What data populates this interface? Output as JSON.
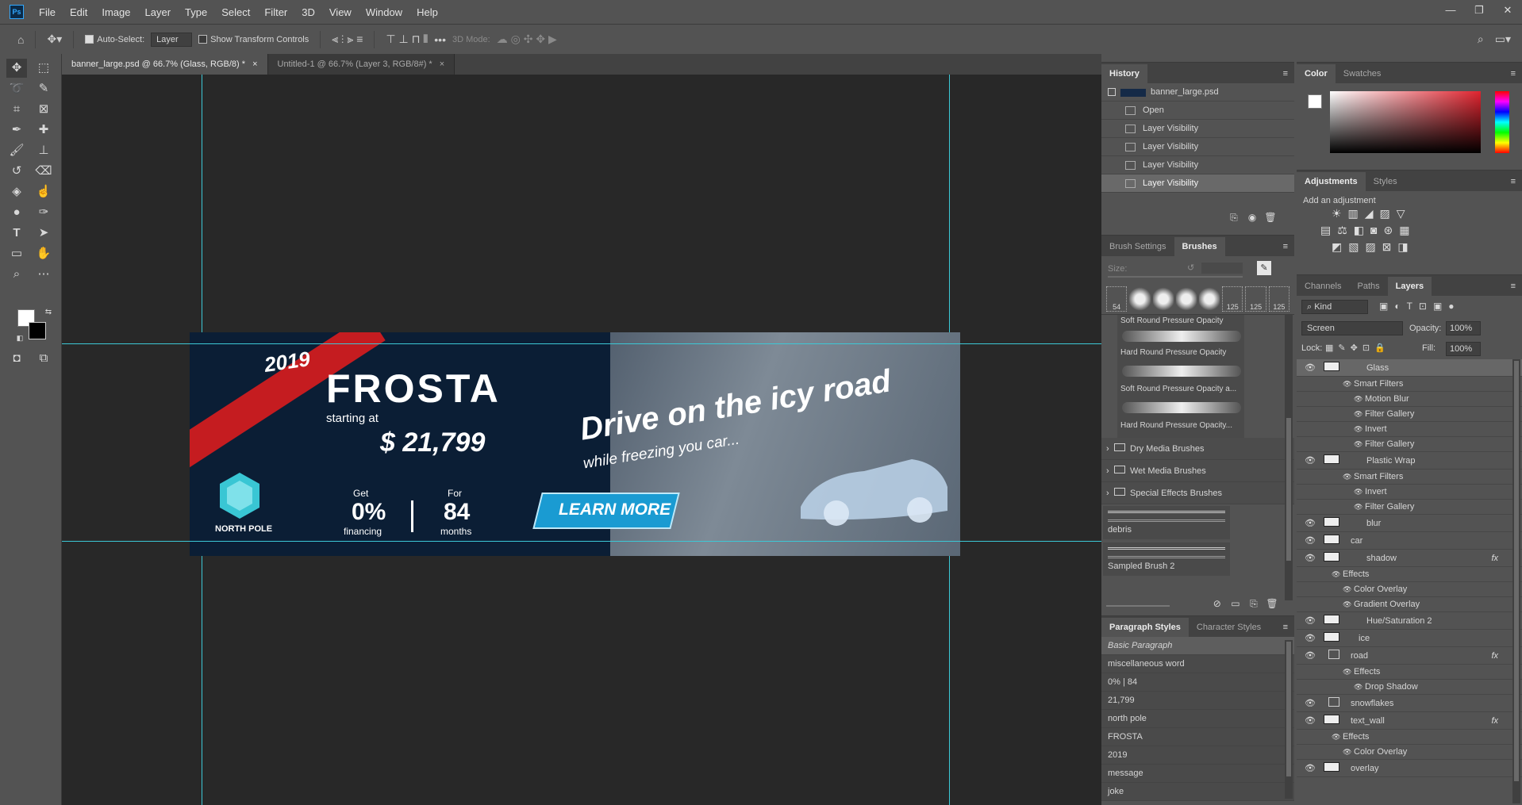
{
  "menubar": {
    "logo": "Ps",
    "items": [
      "File",
      "Edit",
      "Image",
      "Layer",
      "Type",
      "Select",
      "Filter",
      "3D",
      "View",
      "Window",
      "Help"
    ],
    "window_controls": [
      "—",
      "❐",
      "✕"
    ]
  },
  "options": {
    "auto_select_label": "Auto-Select:",
    "auto_select_value": "Layer",
    "transform_label": "Show Transform Controls",
    "mode3d_label": "3D Mode:"
  },
  "tabs": [
    {
      "label": "banner_large.psd @ 66.7% (Glass, RGB/8) *",
      "close": "×"
    },
    {
      "label": "Untitled-1 @ 66.7% (Layer 3, RGB/8#) *",
      "close": "×"
    }
  ],
  "banner": {
    "year": "2019",
    "brand": "FROSTA",
    "starting": "starting at",
    "price": "$ 21,799",
    "headline": "Drive on the icy road",
    "subhead": "while freezing you car...",
    "logo_name": "NORTH POLE",
    "get_label": "Get",
    "get_value": "0%",
    "get_sub": "financing",
    "for_label": "For",
    "for_value": "84",
    "for_sub": "months",
    "cta": "LEARN MORE"
  },
  "history": {
    "tabs": [
      "History"
    ],
    "snapshot": "banner_large.psd",
    "items": [
      "Open",
      "Layer Visibility",
      "Layer Visibility",
      "Layer Visibility",
      "Layer Visibility"
    ]
  },
  "color": {
    "tabs": [
      "Color",
      "Swatches"
    ],
    "fg": "#ffffff",
    "bg": "#000000"
  },
  "adjustments": {
    "tabs": [
      "Adjustments",
      "Styles"
    ],
    "add_label": "Add an adjustment"
  },
  "brushes": {
    "tabs": [
      "Brush Settings",
      "Brushes"
    ],
    "size_label": "Size:",
    "preset_sizes": [
      "54",
      "",
      "",
      "",
      "",
      "125",
      "125",
      "125"
    ],
    "presets": [
      "Soft Round Pressure Opacity",
      "Hard Round Pressure Opacity",
      "Soft Round Pressure Opacity a...",
      "Hard Round Pressure Opacity..."
    ],
    "folders": [
      "Dry Media Brushes",
      "Wet Media Brushes",
      "Special Effects Brushes"
    ],
    "samples": [
      "debris",
      "Sampled Brush 2"
    ]
  },
  "paragraph_styles": {
    "tabs": [
      "Paragraph Styles",
      "Character Styles"
    ],
    "items": [
      "Basic Paragraph",
      "miscellaneous word",
      "0% | 84",
      "21,799",
      "north pole",
      "FROSTA",
      "2019",
      "message",
      "joke"
    ]
  },
  "layers": {
    "tabs": [
      "Channels",
      "Paths",
      "Layers"
    ],
    "filter_value": "Kind",
    "blend_mode": "Screen",
    "opacity_label": "Opacity:",
    "opacity_value": "100%",
    "lock_label": "Lock:",
    "fill_label": "Fill:",
    "fill_value": "100%",
    "fx_symbol": "fx",
    "rows": [
      {
        "name": "Glass",
        "indent": 3
      },
      {
        "name": "Smart Filters",
        "indent": 2
      },
      {
        "name": "Motion Blur",
        "indent": 3
      },
      {
        "name": "Filter Gallery",
        "indent": 3
      },
      {
        "name": "Invert",
        "indent": 3
      },
      {
        "name": "Filter Gallery",
        "indent": 3
      },
      {
        "name": "Plastic Wrap",
        "indent": 3
      },
      {
        "name": "Smart Filters",
        "indent": 2
      },
      {
        "name": "Invert",
        "indent": 3
      },
      {
        "name": "Filter Gallery",
        "indent": 3
      },
      {
        "name": "blur",
        "indent": 3
      },
      {
        "name": "car",
        "indent": 1
      },
      {
        "name": "shadow",
        "indent": 3
      },
      {
        "name": "Effects",
        "indent": 1
      },
      {
        "name": "Color Overlay",
        "indent": 2
      },
      {
        "name": "Gradient Overlay",
        "indent": 2
      },
      {
        "name": "Hue/Saturation 2",
        "indent": 3
      },
      {
        "name": "ice",
        "indent": 2
      },
      {
        "name": "road",
        "indent": 1
      },
      {
        "name": "Effects",
        "indent": 2
      },
      {
        "name": "Drop Shadow",
        "indent": 3
      },
      {
        "name": "snowflakes",
        "indent": 1
      },
      {
        "name": "text_wall",
        "indent": 1
      },
      {
        "name": "Effects",
        "indent": 1
      },
      {
        "name": "Color Overlay",
        "indent": 2
      },
      {
        "name": "overlay",
        "indent": 1
      }
    ]
  }
}
